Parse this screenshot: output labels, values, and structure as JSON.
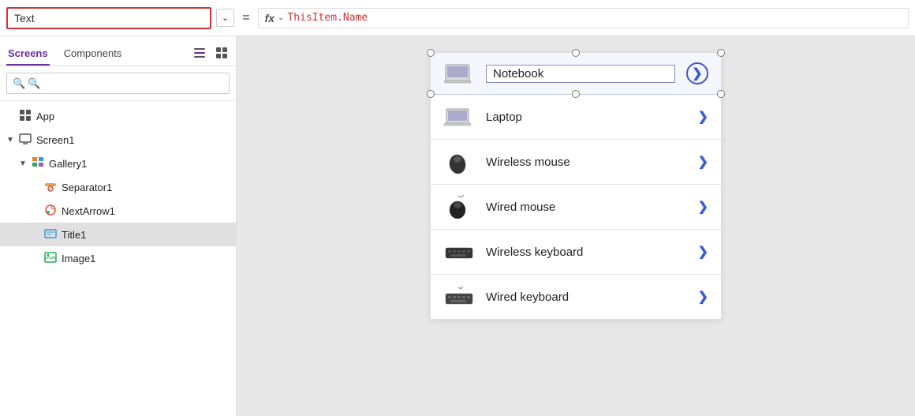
{
  "topbar": {
    "property_label": "Text",
    "property_placeholder": "Text",
    "equals": "=",
    "formula_icon": "fx",
    "formula_value": "ThisItem.Name"
  },
  "sidebar": {
    "tabs": [
      {
        "id": "screens",
        "label": "Screens",
        "active": true
      },
      {
        "id": "components",
        "label": "Components",
        "active": false
      }
    ],
    "search_placeholder": "Search",
    "tree": [
      {
        "id": "app",
        "label": "App",
        "indent": 1,
        "icon": "app",
        "arrow": "",
        "has_arrow": false
      },
      {
        "id": "screen1",
        "label": "Screen1",
        "indent": 1,
        "icon": "screen",
        "arrow": "▾",
        "has_arrow": true
      },
      {
        "id": "gallery1",
        "label": "Gallery1",
        "indent": 2,
        "icon": "gallery",
        "arrow": "▾",
        "has_arrow": true
      },
      {
        "id": "separator1",
        "label": "Separator1",
        "indent": 3,
        "icon": "separator",
        "arrow": "",
        "has_arrow": false
      },
      {
        "id": "nextarrow1",
        "label": "NextArrow1",
        "indent": 3,
        "icon": "nextarrow",
        "arrow": "",
        "has_arrow": false
      },
      {
        "id": "title1",
        "label": "Title1",
        "indent": 3,
        "icon": "title",
        "arrow": "",
        "has_arrow": false,
        "selected": true
      },
      {
        "id": "image1",
        "label": "Image1",
        "indent": 3,
        "icon": "image",
        "arrow": "",
        "has_arrow": false
      }
    ]
  },
  "gallery": {
    "items": [
      {
        "id": "notebook",
        "label": "Notebook",
        "selected": true
      },
      {
        "id": "laptop",
        "label": "Laptop",
        "selected": false
      },
      {
        "id": "wireless-mouse",
        "label": "Wireless mouse",
        "selected": false
      },
      {
        "id": "wired-mouse",
        "label": "Wired mouse",
        "selected": false
      },
      {
        "id": "wireless-keyboard",
        "label": "Wireless keyboard",
        "selected": false
      },
      {
        "id": "wired-keyboard",
        "label": "Wired keyboard",
        "selected": false
      }
    ]
  },
  "icons": {
    "search": "🔍",
    "list_view": "☰",
    "grid_view": "⊞",
    "app_icon": "⊞",
    "screen_icon": "▢",
    "arrow_right": "❯"
  }
}
